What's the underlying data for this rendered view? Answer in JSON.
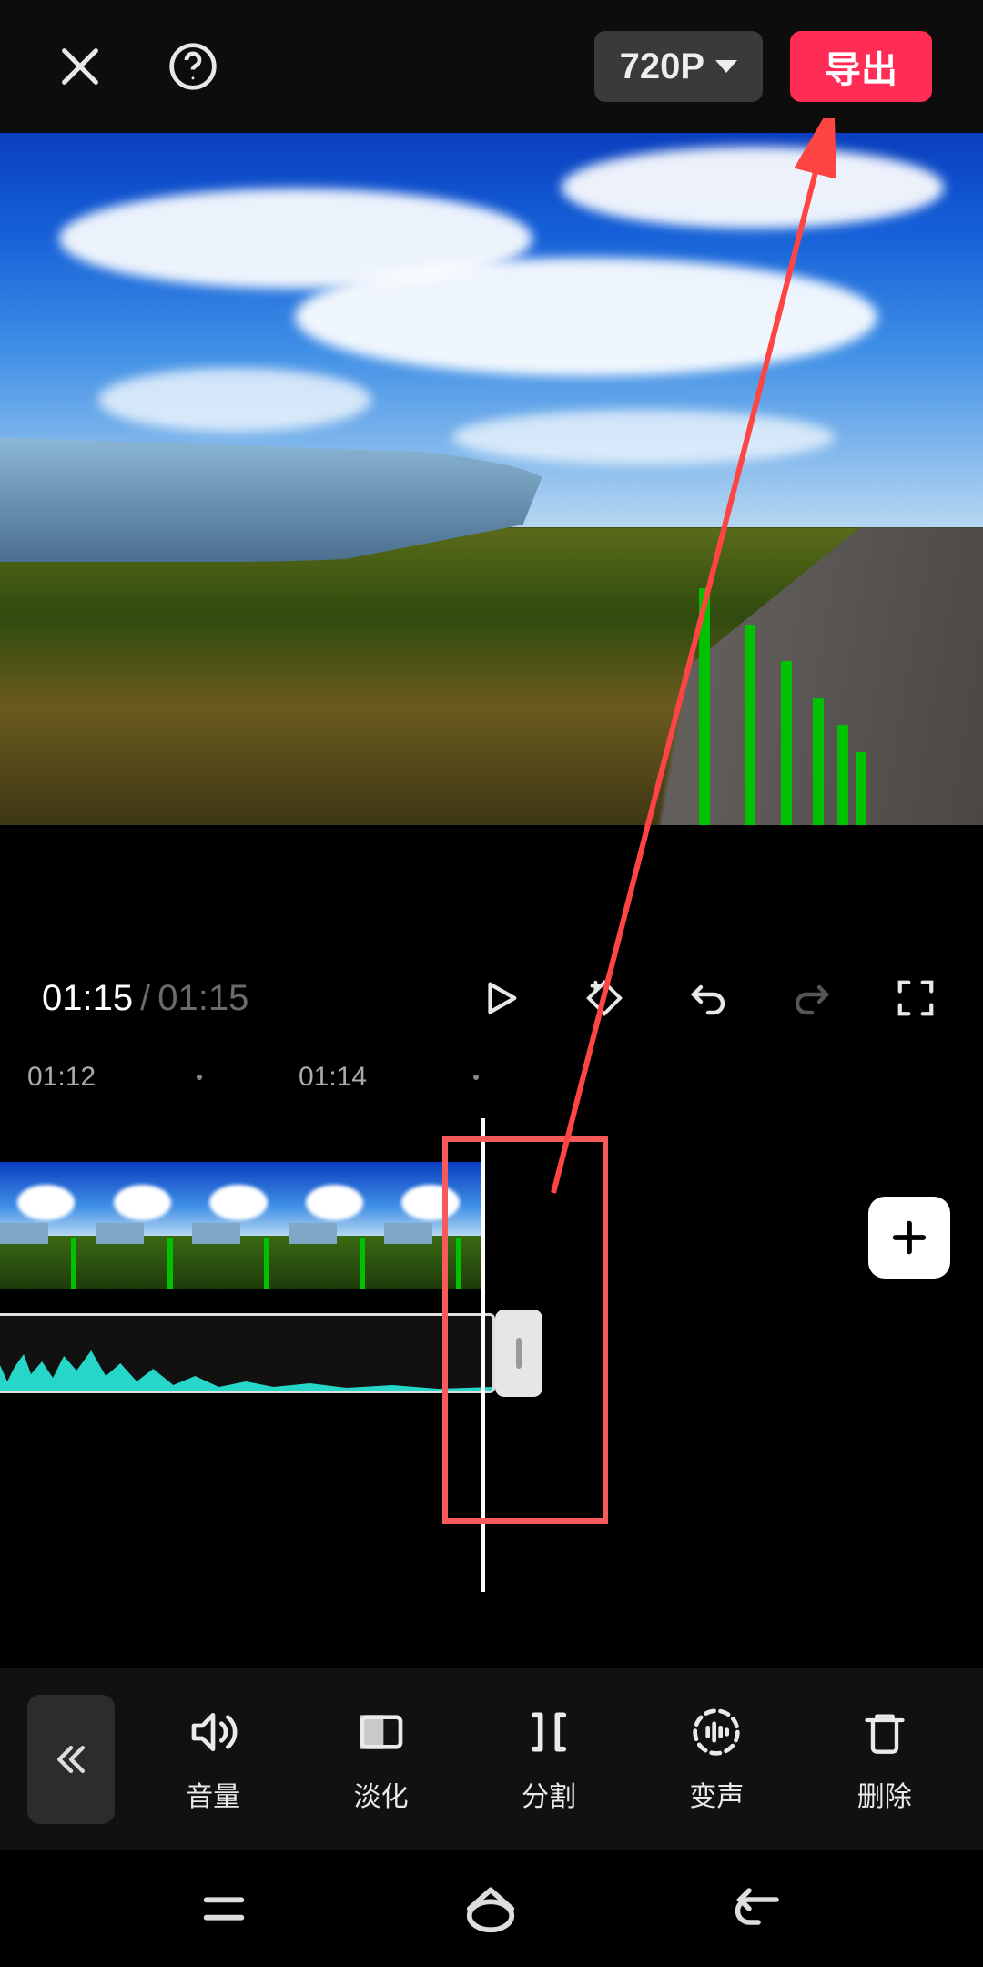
{
  "header": {
    "resolution_label": "720P",
    "export_label": "导出"
  },
  "playback": {
    "current_time": "01:15",
    "total_time": "01:15"
  },
  "timeline": {
    "ruler": [
      "01:12",
      "01:14"
    ]
  },
  "toolbar": {
    "collapse_icon": "chevron-double-left",
    "tools": [
      {
        "icon": "volume-icon",
        "label": "音量"
      },
      {
        "icon": "fade-icon",
        "label": "淡化"
      },
      {
        "icon": "split-icon",
        "label": "分割"
      },
      {
        "icon": "voice-change-icon",
        "label": "变声"
      },
      {
        "icon": "delete-icon",
        "label": "删除"
      }
    ]
  }
}
